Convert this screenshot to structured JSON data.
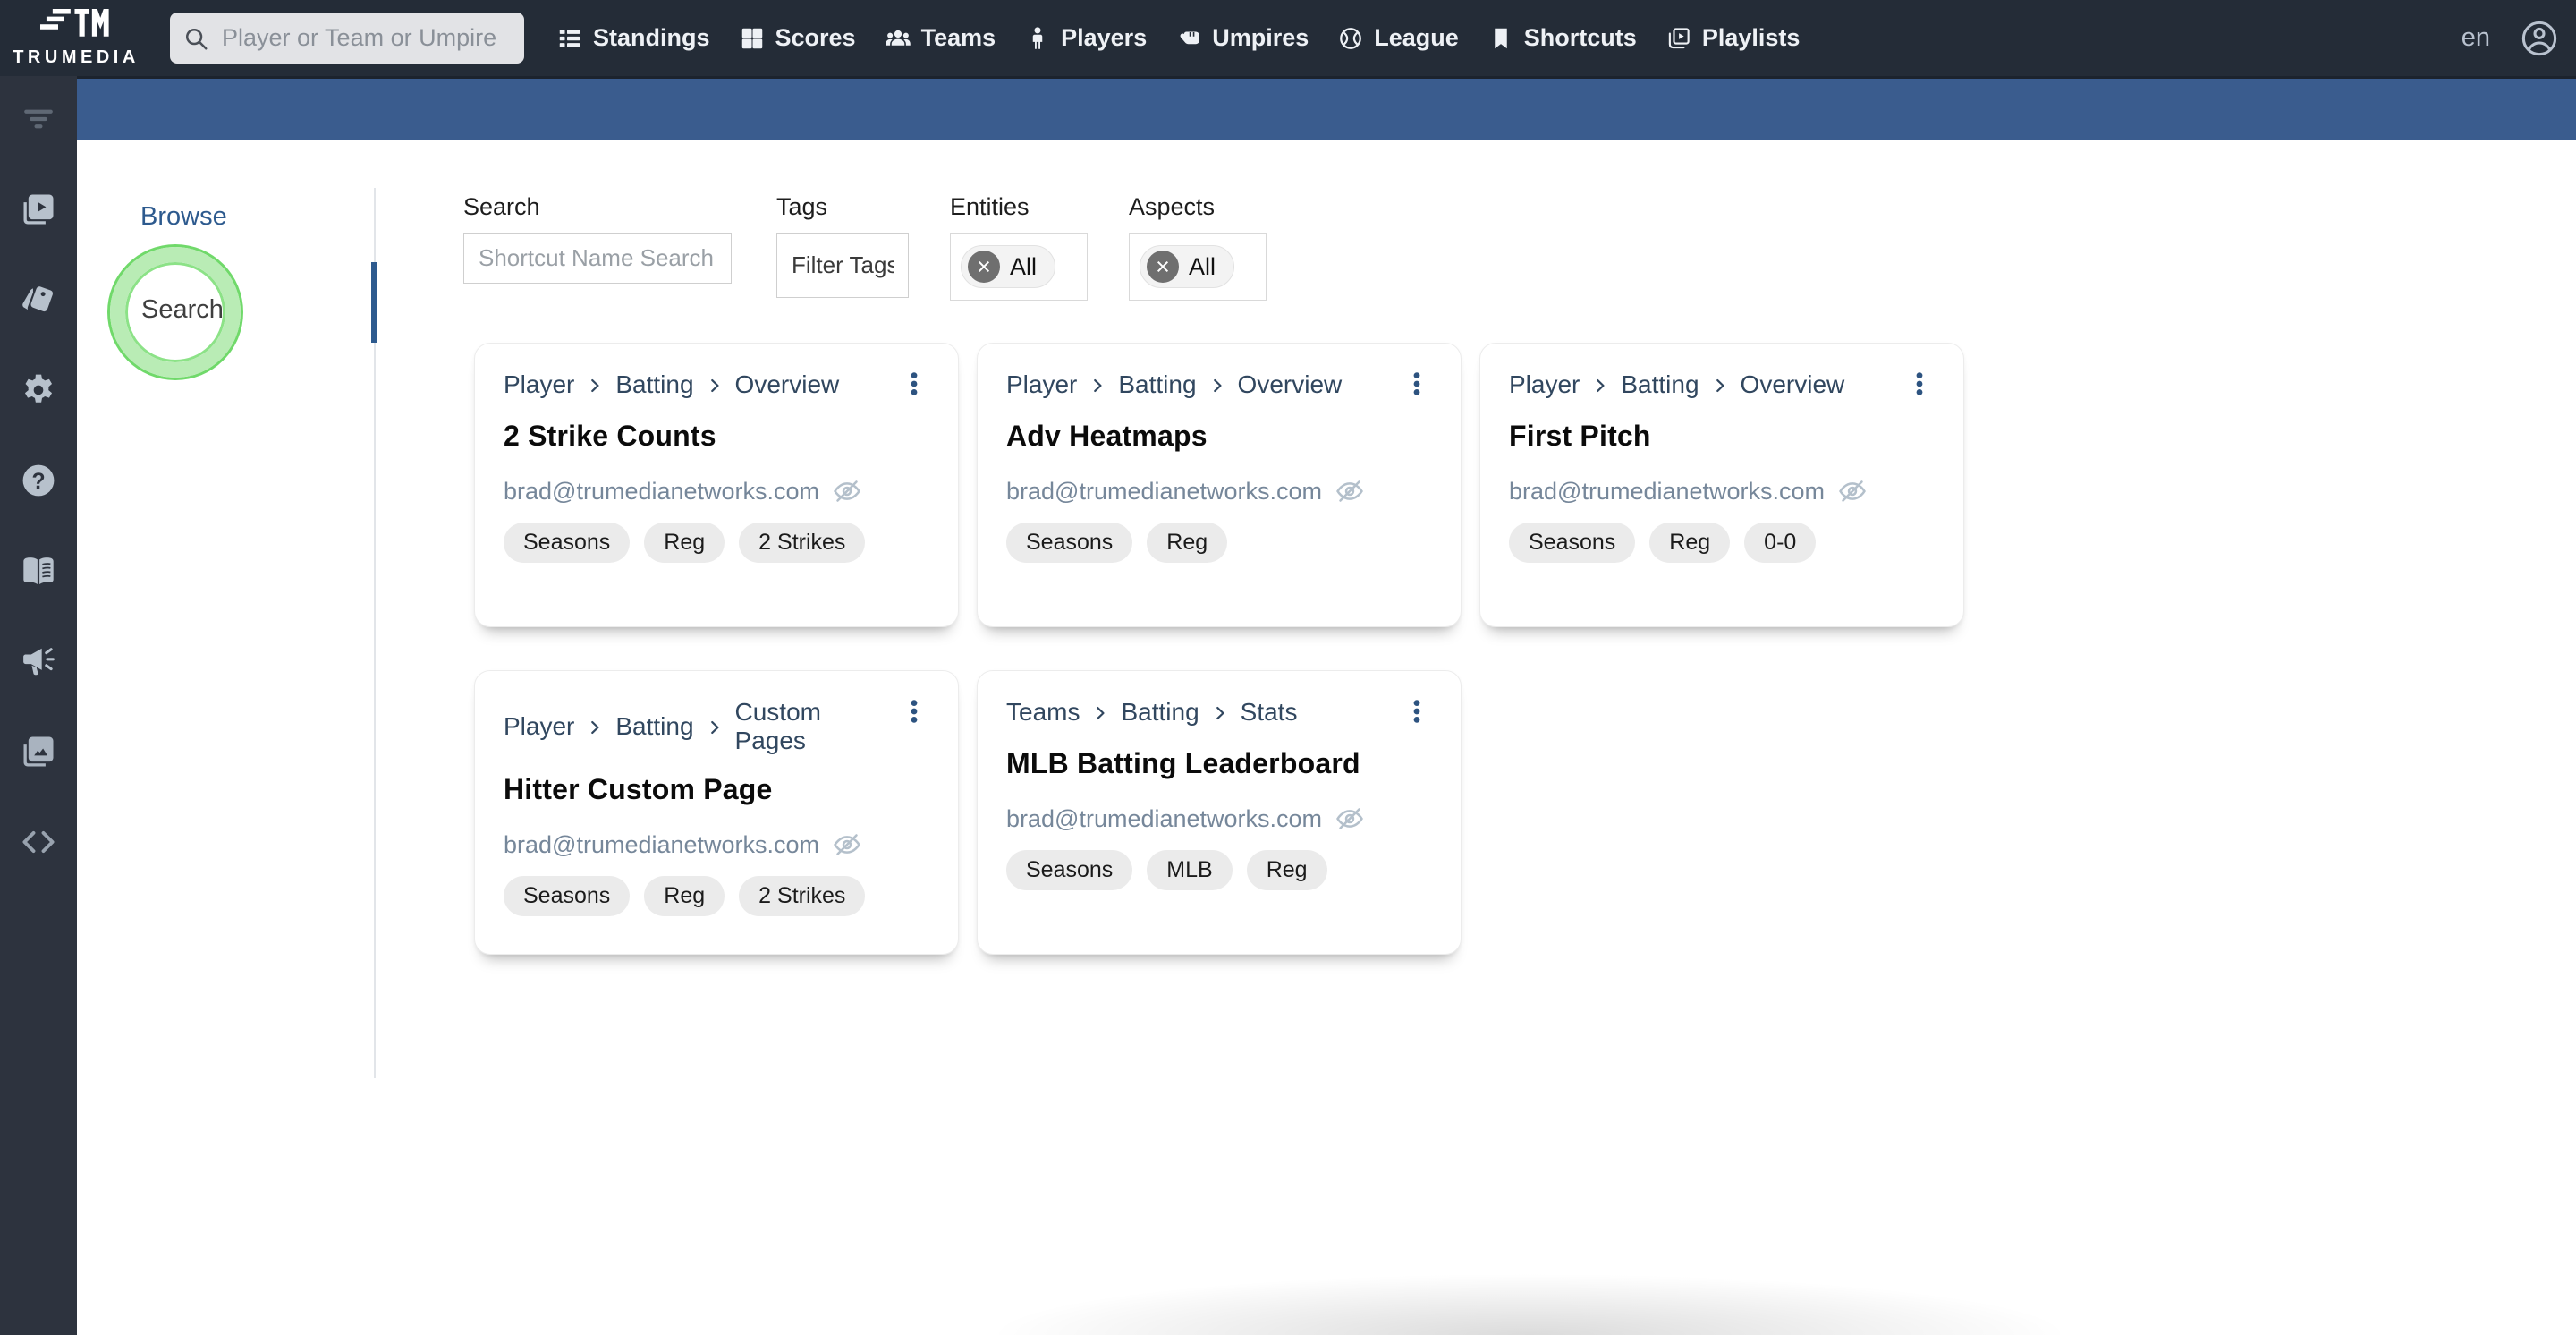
{
  "topbar": {
    "logo_text": "TRUMEDIA",
    "search_placeholder": "Player or Team or Umpire",
    "locale": "en",
    "nav_items": [
      {
        "label": "Standings",
        "icon": "standings-icon"
      },
      {
        "label": "Scores",
        "icon": "scores-icon"
      },
      {
        "label": "Teams",
        "icon": "teams-icon"
      },
      {
        "label": "Players",
        "icon": "players-icon"
      },
      {
        "label": "Umpires",
        "icon": "umpires-icon"
      },
      {
        "label": "League",
        "icon": "league-icon"
      },
      {
        "label": "Shortcuts",
        "icon": "shortcuts-icon"
      },
      {
        "label": "Playlists",
        "icon": "playlists-icon"
      }
    ]
  },
  "sidebar": {
    "items": [
      {
        "icon": "filter-icon"
      },
      {
        "icon": "video-playlist-icon"
      },
      {
        "icon": "tags-icon"
      },
      {
        "icon": "gear-icon"
      },
      {
        "icon": "help-icon"
      },
      {
        "icon": "book-icon"
      },
      {
        "icon": "megaphone-icon"
      },
      {
        "icon": "images-icon"
      },
      {
        "icon": "code-icon"
      }
    ]
  },
  "browse_panel": {
    "browse_label": "Browse",
    "search_label": "Search"
  },
  "filters": {
    "search": {
      "label": "Search",
      "placeholder": "Shortcut Name Search"
    },
    "tags": {
      "label": "Tags",
      "placeholder": "Filter Tags"
    },
    "entities": {
      "label": "Entities",
      "selected": "All"
    },
    "aspects": {
      "label": "Aspects",
      "selected": "All"
    }
  },
  "cards": [
    {
      "breadcrumb": [
        "Player",
        "Batting",
        "Overview"
      ],
      "title": "2 Strike Counts",
      "owner": "brad@trumedianetworks.com",
      "tags": [
        "Seasons",
        "Reg",
        "2 Strikes"
      ]
    },
    {
      "breadcrumb": [
        "Player",
        "Batting",
        "Overview"
      ],
      "title": "Adv Heatmaps",
      "owner": "brad@trumedianetworks.com",
      "tags": [
        "Seasons",
        "Reg"
      ]
    },
    {
      "breadcrumb": [
        "Player",
        "Batting",
        "Overview"
      ],
      "title": "First Pitch",
      "owner": "brad@trumedianetworks.com",
      "tags": [
        "Seasons",
        "Reg",
        "0-0"
      ]
    },
    {
      "breadcrumb": [
        "Player",
        "Batting",
        "Custom Pages"
      ],
      "title": "Hitter Custom Page",
      "owner": "brad@trumedianetworks.com",
      "tags": [
        "Seasons",
        "Reg",
        "2 Strikes"
      ]
    },
    {
      "breadcrumb": [
        "Teams",
        "Batting",
        "Stats"
      ],
      "title": "MLB Batting Leaderboard",
      "owner": "brad@trumedianetworks.com",
      "tags": [
        "Seasons",
        "MLB",
        "Reg"
      ]
    }
  ],
  "colors": {
    "topbar_bg": "#242c37",
    "sidebar_bg": "#2d333e",
    "subbar_bg": "#3a5c8e",
    "accent_blue": "#2d5a8e",
    "highlight_green": "#70d96a"
  }
}
